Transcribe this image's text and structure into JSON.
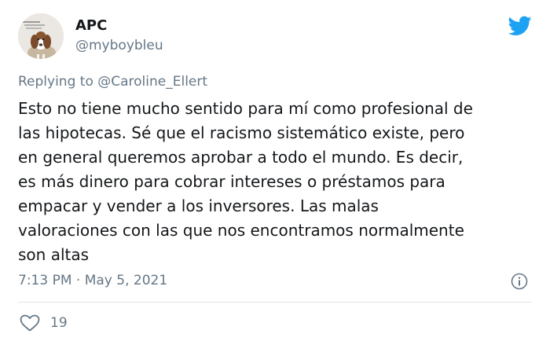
{
  "tweet": {
    "author": {
      "display_name": "APC",
      "handle": "@myboybleu",
      "avatar_icon": "dog-avatar-icon"
    },
    "brand_icon": "twitter-bird-icon",
    "reply_prefix": "Replying to",
    "reply_to": "@Caroline_Ellert",
    "body_lines": [
      "Esto no tiene mucho sentido para mí como profesional de",
      "las hipotecas. Sé que el racismo sistemático existe, pero",
      "en general queremos aprobar a todo el mundo. Es decir,",
      "es más dinero para cobrar intereses o préstamos para",
      "empacar y vender a los inversores. Las malas",
      "valoraciones con las que nos encontramos normalmente",
      "son altas"
    ],
    "time": "7:13 PM",
    "separator": "·",
    "date": "May 5, 2021",
    "info_icon": "info-icon",
    "like_icon": "heart-icon",
    "like_count": "19"
  },
  "colors": {
    "brand_blue": "#1da1f2",
    "text_primary": "#14171a",
    "text_secondary": "#657786",
    "divider": "#e1e8ed"
  }
}
